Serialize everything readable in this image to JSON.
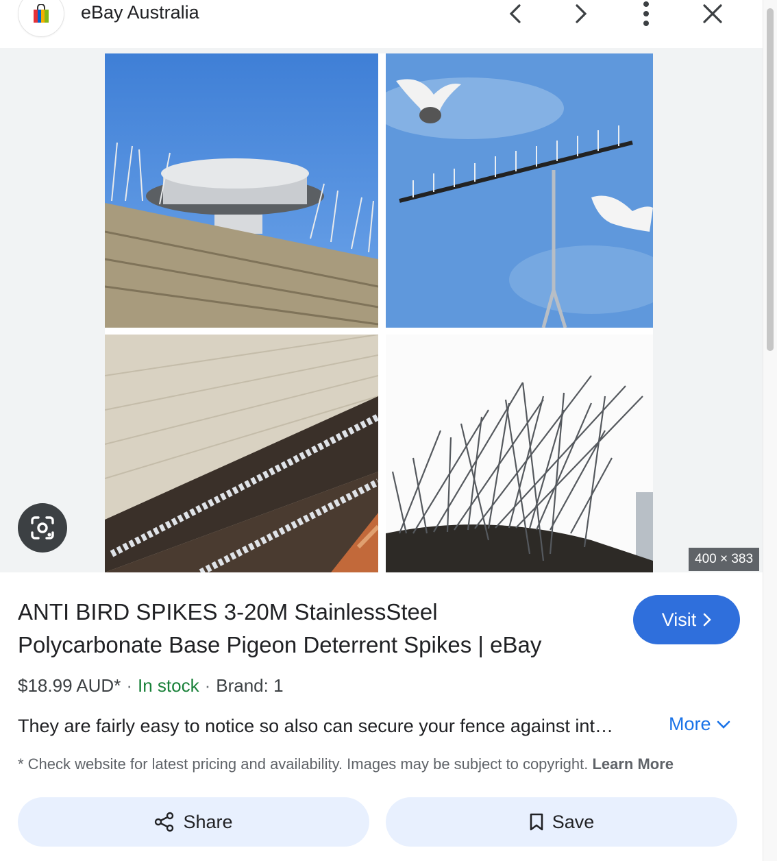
{
  "header": {
    "site_name": "eBay Australia",
    "icons": [
      "shopping-bag-icon",
      "chevron-left-icon",
      "chevron-right-icon",
      "more-vert-icon",
      "close-icon"
    ]
  },
  "image": {
    "dimensions": "400 × 383",
    "lens_icon": "google-lens-icon"
  },
  "result": {
    "title_line1": "ANTI BIRD SPIKES 3-20M StainlessSteel",
    "title_line2": "Polycarbonate Base Pigeon Deterrent Spikes | eBay",
    "visit_label": "Visit",
    "price": "$18.99 AUD*",
    "separator": "·",
    "stock": "In stock",
    "brand": "Brand: 1",
    "description": "They are fairly easy to notice so also can secure your fence against intruders and pests.",
    "more_label": "More",
    "disclaimer": "* Check website for latest pricing and availability. Images may be subject to copyright.",
    "learn_more": "Learn More"
  },
  "actions": {
    "share_label": "Share",
    "save_label": "Save"
  },
  "colors": {
    "accent": "#2f6fdc",
    "link": "#1a73e8",
    "in_stock": "#188038",
    "action_bg": "#e8f0fe"
  }
}
